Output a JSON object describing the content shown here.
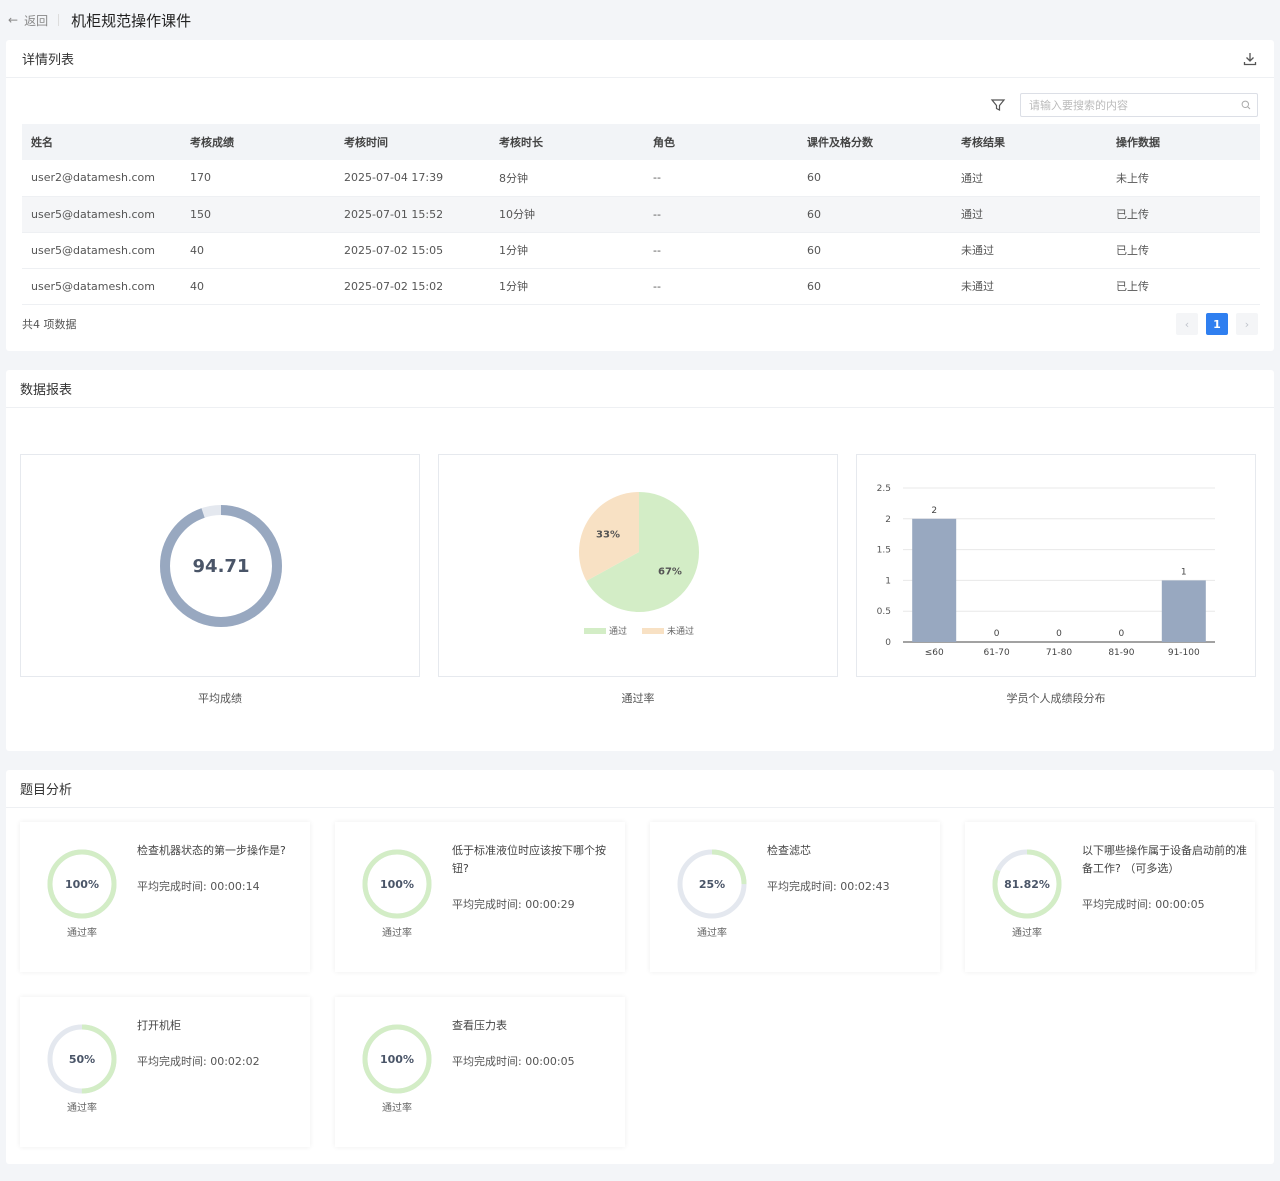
{
  "header": {
    "back_label": "返回",
    "title": "机柜规范操作课件"
  },
  "list": {
    "title": "详情列表",
    "search_placeholder": "请输入要搜索的内容",
    "columns": [
      "姓名",
      "考核成绩",
      "考核时间",
      "考核时长",
      "角色",
      "课件及格分数",
      "考核结果",
      "操作数据"
    ],
    "rows": [
      [
        "user2@datamesh.com",
        "170",
        "2025-07-04 17:39",
        "8分钟",
        "--",
        "60",
        "通过",
        "未上传"
      ],
      [
        "user5@datamesh.com",
        "150",
        "2025-07-01 15:52",
        "10分钟",
        "--",
        "60",
        "通过",
        "已上传"
      ],
      [
        "user5@datamesh.com",
        "40",
        "2025-07-02 15:05",
        "1分钟",
        "--",
        "60",
        "未通过",
        "已上传"
      ],
      [
        "user5@datamesh.com",
        "40",
        "2025-07-02 15:02",
        "1分钟",
        "--",
        "60",
        "未通过",
        "已上传"
      ]
    ],
    "total_label": "共4 项数据",
    "pager": {
      "prev": "‹",
      "page": "1",
      "next": "›"
    }
  },
  "report": {
    "title": "数据报表",
    "avg_caption": "平均成绩",
    "pass_caption": "通过率",
    "dist_caption": "学员个人成绩段分布"
  },
  "chart_data": [
    {
      "type": "donut",
      "value": 94.71,
      "label": "94.71",
      "fraction": 0.9471,
      "color": "#98a8c0"
    },
    {
      "type": "pie",
      "slices": [
        {
          "name": "通过",
          "value": 67,
          "label": "67%",
          "color": "#d3edc6"
        },
        {
          "name": "未通过",
          "value": 33,
          "label": "33%",
          "color": "#f8e1c4"
        }
      ]
    },
    {
      "type": "bar",
      "categories": [
        "≤60",
        "61-70",
        "71-80",
        "81-90",
        "91-100"
      ],
      "values": [
        2,
        0,
        0,
        0,
        1
      ],
      "ylim": [
        0,
        2.5
      ],
      "yticks": [
        "0",
        "0.5",
        "1",
        "1.5",
        "2",
        "2.5"
      ],
      "color": "#98a8c0"
    }
  ],
  "questions": {
    "title": "题目分析",
    "rate_label": "通过率",
    "items": [
      {
        "rate": "100%",
        "fraction": 1.0,
        "title": "检查机器状态的第一步操作是?",
        "time": "平均完成时间: 00:00:14"
      },
      {
        "rate": "100%",
        "fraction": 1.0,
        "title": "低于标准液位时应该按下哪个按钮?",
        "time": "平均完成时间: 00:00:29"
      },
      {
        "rate": "25%",
        "fraction": 0.25,
        "title": "检查滤芯",
        "time": "平均完成时间: 00:02:43"
      },
      {
        "rate": "81.82%",
        "fraction": 0.8182,
        "title": "以下哪些操作属于设备启动前的准备工作? （可多选）",
        "time": "平均完成时间: 00:00:05"
      },
      {
        "rate": "50%",
        "fraction": 0.5,
        "title": "打开机柜",
        "time": "平均完成时间: 00:02:02"
      },
      {
        "rate": "100%",
        "fraction": 1.0,
        "title": "查看压力表",
        "time": "平均完成时间: 00:00:05"
      }
    ]
  }
}
